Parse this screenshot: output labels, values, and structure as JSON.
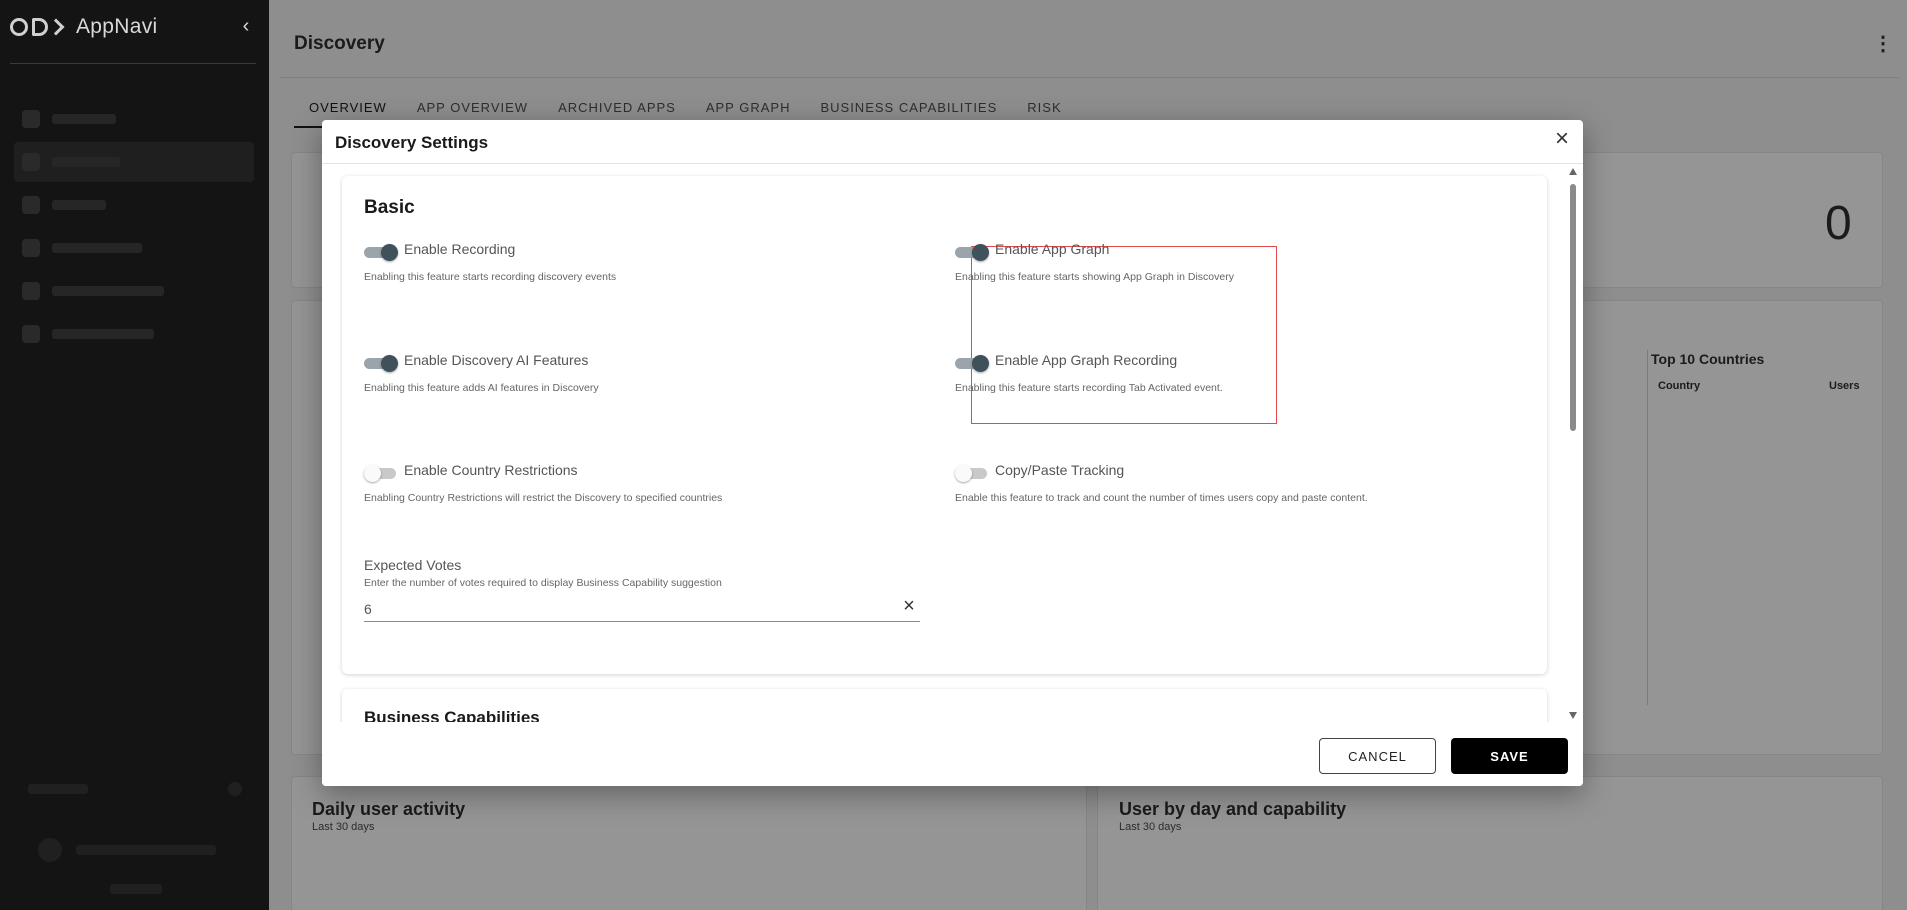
{
  "app": {
    "name": "AppNavi",
    "collapse_icon": "chevron-left-icon"
  },
  "page": {
    "title": "Discovery",
    "more_icon": "vertical-dots-icon",
    "tabs": [
      {
        "label": "OVERVIEW",
        "active": true
      },
      {
        "label": "APP OVERVIEW",
        "active": false
      },
      {
        "label": "ARCHIVED APPS",
        "active": false
      },
      {
        "label": "APP GRAPH",
        "active": false
      },
      {
        "label": "BUSINESS CAPABILITIES",
        "active": false
      },
      {
        "label": "RISK",
        "active": false
      }
    ],
    "stat_value": "0",
    "countries": {
      "title": "Top 10 Countries",
      "col_country": "Country",
      "col_users": "Users"
    },
    "daily_activity": {
      "title": "Daily user activity",
      "subtitle": "Last 30 days"
    },
    "user_by_day": {
      "title": "User by day and capability",
      "subtitle": "Last 30 days"
    }
  },
  "modal": {
    "title": "Discovery Settings",
    "close_icon": "close-icon",
    "sections": {
      "basic": {
        "title": "Basic",
        "settings": [
          {
            "label": "Enable Recording",
            "description": "Enabling this feature starts recording discovery events",
            "enabled": true
          },
          {
            "label": "Enable App Graph",
            "description": "Enabling this feature starts showing App Graph in Discovery",
            "enabled": true
          },
          {
            "label": "Enable Discovery AI Features",
            "description": "Enabling this feature adds AI features in Discovery",
            "enabled": true
          },
          {
            "label": "Enable App Graph Recording",
            "description": "Enabling this feature starts recording Tab Activated event.",
            "enabled": true
          },
          {
            "label": "Enable Country Restrictions",
            "description": "Enabling Country Restrictions will restrict the Discovery to specified countries",
            "enabled": false
          },
          {
            "label": "Copy/Paste Tracking",
            "description": "Enable this feature to track and count the number of times users copy and paste content.",
            "enabled": false
          }
        ],
        "expected_votes": {
          "label": "Expected Votes",
          "help": "Enter the number of votes required to display Business Capability suggestion",
          "value": "6"
        }
      },
      "business_capabilities": {
        "title": "Business Capabilities"
      }
    },
    "buttons": {
      "cancel": "CANCEL",
      "save": "SAVE"
    }
  },
  "colors": {
    "highlight": "#e34a4a",
    "switch_on": "#3f525c",
    "save_bg": "#000000"
  }
}
